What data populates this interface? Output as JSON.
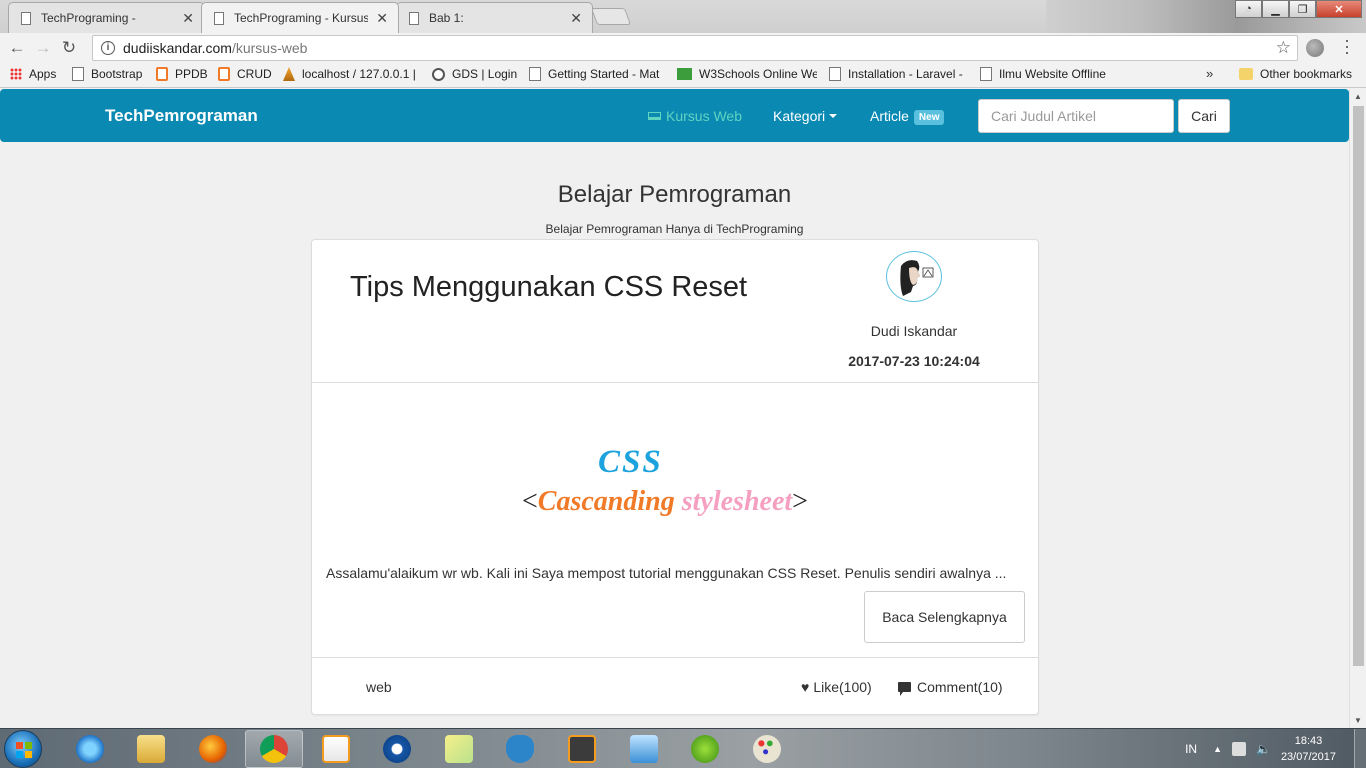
{
  "browser": {
    "tabs": [
      {
        "title": "TechPrograming -",
        "active": false
      },
      {
        "title": "TechPrograming - Kursus",
        "active": true
      },
      {
        "title": "Bab 1:",
        "active": false
      }
    ],
    "address": {
      "host": "dudiiskandar.com",
      "path": "/kursus-web"
    },
    "bookmarks": [
      {
        "label": "Apps",
        "icon": "apps-grid-icon"
      },
      {
        "label": "Bootstrap",
        "icon": "page-icon"
      },
      {
        "label": "PPDB",
        "icon": "xampp-icon"
      },
      {
        "label": "CRUD",
        "icon": "xampp-icon"
      },
      {
        "label": "localhost / 127.0.0.1 |",
        "icon": "phpmyadmin-icon"
      },
      {
        "label": "GDS | Login",
        "icon": "gds-icon"
      },
      {
        "label": "Getting Started - Mat",
        "icon": "page-icon"
      },
      {
        "label": "W3Schools Online We",
        "icon": "w3schools-icon"
      },
      {
        "label": "Installation - Laravel -",
        "icon": "page-icon"
      },
      {
        "label": "Ilmu Website Offline",
        "icon": "page-icon"
      }
    ],
    "bookmarks_more": "»",
    "other_bookmarks": "Other bookmarks"
  },
  "site": {
    "brand": "TechPemrograman",
    "nav": {
      "kursus": "Kursus Web",
      "kategori": "Kategori",
      "article": "Article",
      "article_badge": "New"
    },
    "search": {
      "placeholder": "Cari Judul Artikel",
      "button": "Cari"
    },
    "heading": "Belajar Pemrograman",
    "subheading": "Belajar Pemrograman Hanya di TechPrograming",
    "colors": {
      "navbar": "#0a8ab3",
      "active_nav": "#5fd4c0",
      "badge": "#5bc0de"
    }
  },
  "post": {
    "title": "Tips Menggunakan CSS Reset",
    "author": "Dudi Iskandar",
    "date": "2017-07-23 10:24:04",
    "hero": {
      "word": "CSS",
      "open": "<",
      "part1": "Cascanding",
      "part2": "stylesheet",
      "close": ">"
    },
    "excerpt": "Assalamu'alaikum wr wb. Kali ini Saya mempost tutorial menggunakan CSS Reset. Penulis sendiri awalnya ...",
    "read_more": "Baca Selengkapnya",
    "tag": "web",
    "like": "Like(100)",
    "comment": "Comment(10)"
  },
  "taskbar": {
    "apps": [
      "internet-explorer-icon",
      "file-explorer-icon",
      "firefox-icon",
      "chrome-icon",
      "media-player-icon",
      "ccleaner-icon",
      "sticky-notes-icon",
      "evernote-icon",
      "sublime-text-icon",
      "control-panel-icon",
      "hotspot-shield-icon",
      "paint-icon"
    ],
    "language": "IN",
    "time": "18:43",
    "date": "23/07/2017"
  }
}
